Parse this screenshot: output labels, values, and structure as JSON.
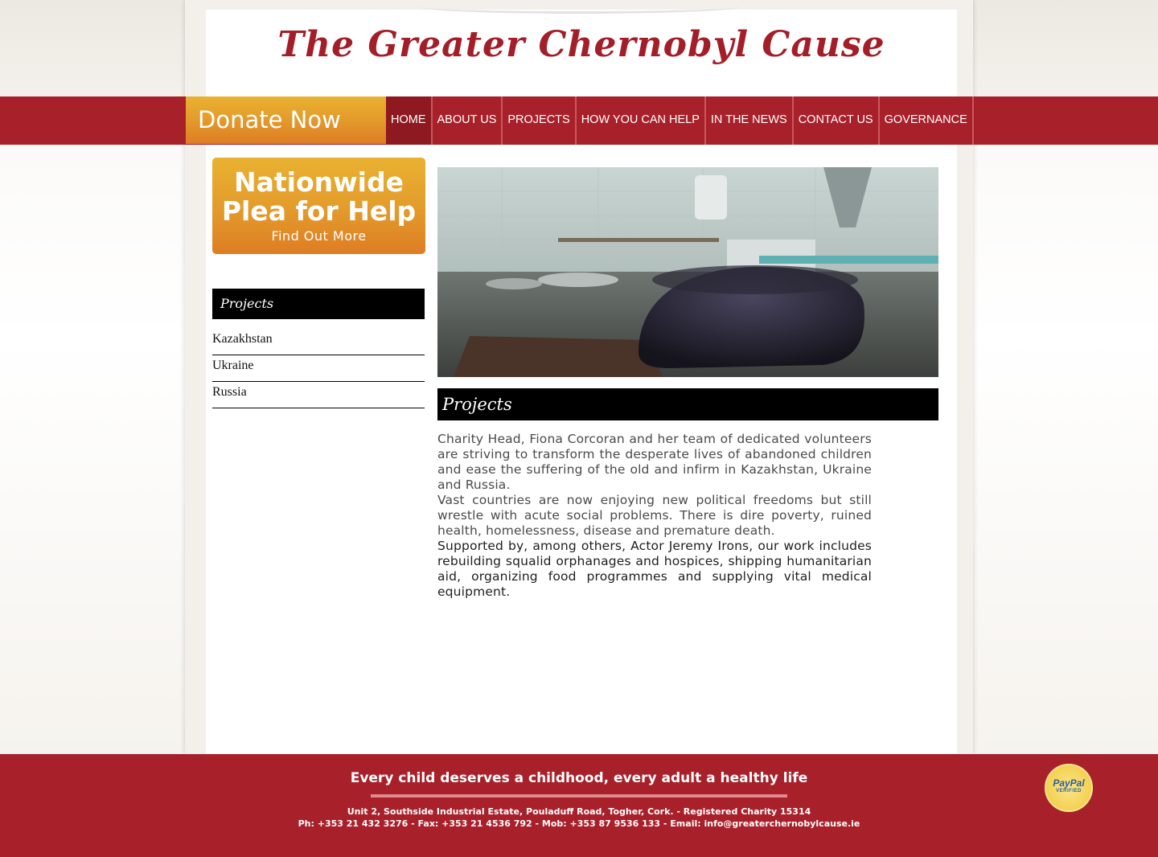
{
  "site": {
    "title": "The Greater Chernobyl Cause"
  },
  "nav": {
    "donate_label": "Donate Now",
    "items": [
      {
        "label": "HOME",
        "active": true
      },
      {
        "label": "ABOUT US"
      },
      {
        "label": "PROJECTS"
      },
      {
        "label": "HOW YOU CAN HELP"
      },
      {
        "label": "IN THE NEWS"
      },
      {
        "label": "CONTACT US"
      },
      {
        "label": "GOVERNANCE"
      }
    ]
  },
  "sidebar": {
    "banner_title_line1": "Nationwide",
    "banner_title_line2": "Plea for Help",
    "banner_link": "Find Out More",
    "heading": "Projects",
    "links": [
      "Kazakhstan",
      "Ukraine",
      "Russia"
    ]
  },
  "main": {
    "heading": "Projects",
    "paragraphs": [
      "Charity Head, Fiona Corcoran and her team of dedicated volunteers are striving to transform the desperate lives of abandoned children and ease the suffering of the old and infirm in Kazakhstan, Ukraine and Russia.",
      "Vast countries are now enjoying new political freedoms but still wrestle with acute social problems. There is dire poverty, ruined health, homelessness, disease and premature death.",
      "Supported by, among others, Actor Jeremy Irons, our work includes rebuilding squalid orphanages and hospices, shipping humanitarian aid, organizing food programmes and supplying vital medical equipment."
    ]
  },
  "footer": {
    "tagline": "Every child deserves a childhood, every adult a healthy life",
    "address": "Unit 2, Southside Industrial Estate, Pouladuff Road, Togher, Cork. - Registered Charity 15314",
    "contact": "Ph: +353 21 432 3276 - Fax: +353 21 4536 792 - Mob: +353 87 9536 133 - Email: info@greaterchernobylcause.ie",
    "paypal_brand": "PayPal",
    "paypal_verified": "VERIFIED"
  },
  "colors": {
    "brand_red": "#a8202a",
    "donate_orange": "#e39a2b",
    "title_red": "#a31e28"
  }
}
